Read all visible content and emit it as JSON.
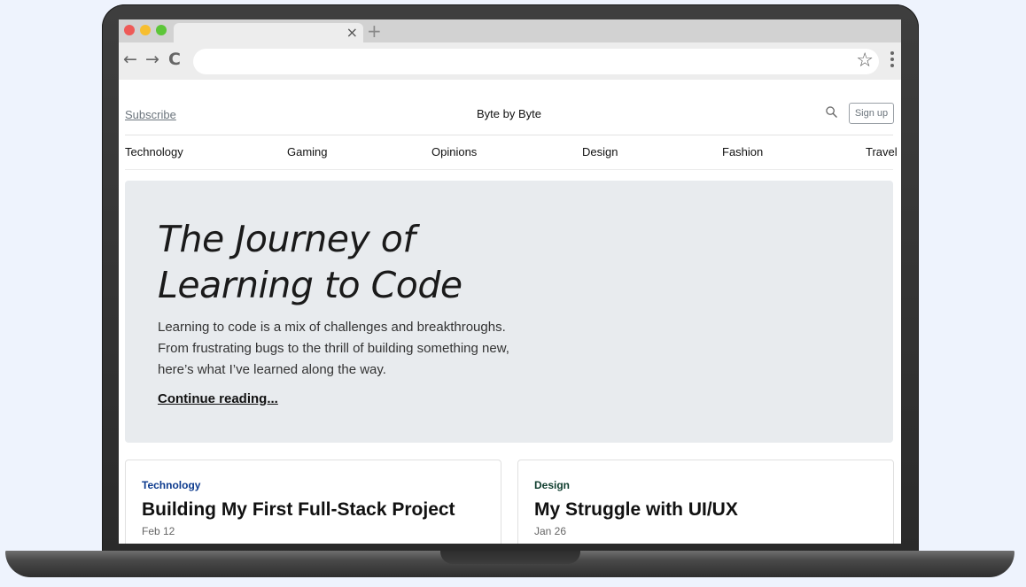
{
  "browser": {
    "tab_close": "×",
    "new_tab": "+",
    "back": "←",
    "forward": "→",
    "reload": "C",
    "bookmark": "☆",
    "address": ""
  },
  "site": {
    "subscribe": "Subscribe",
    "brand": "Byte by Byte",
    "signup": "Sign up"
  },
  "nav": [
    {
      "label": "Technology"
    },
    {
      "label": "Gaming"
    },
    {
      "label": "Opinions"
    },
    {
      "label": "Design"
    },
    {
      "label": "Fashion"
    },
    {
      "label": "Travel"
    }
  ],
  "hero": {
    "title_line1": "The Journey of",
    "title_line2": "Learning to Code",
    "text_line1": "Learning to code is a mix of challenges and breakthroughs.",
    "text_line2": "From frustrating bugs to the thrill of building something new,",
    "text_line3": "here’s what I’ve learned along the way.",
    "link": "Continue reading..."
  },
  "cards": [
    {
      "category": "Technology",
      "title": "Building My First Full-Stack Project",
      "date": "Feb 12",
      "category_color": "#0d3b8e"
    },
    {
      "category": "Design",
      "title": "My Struggle with UI/UX",
      "date": "Jan 26",
      "category_color": "#0f3d2e"
    }
  ]
}
